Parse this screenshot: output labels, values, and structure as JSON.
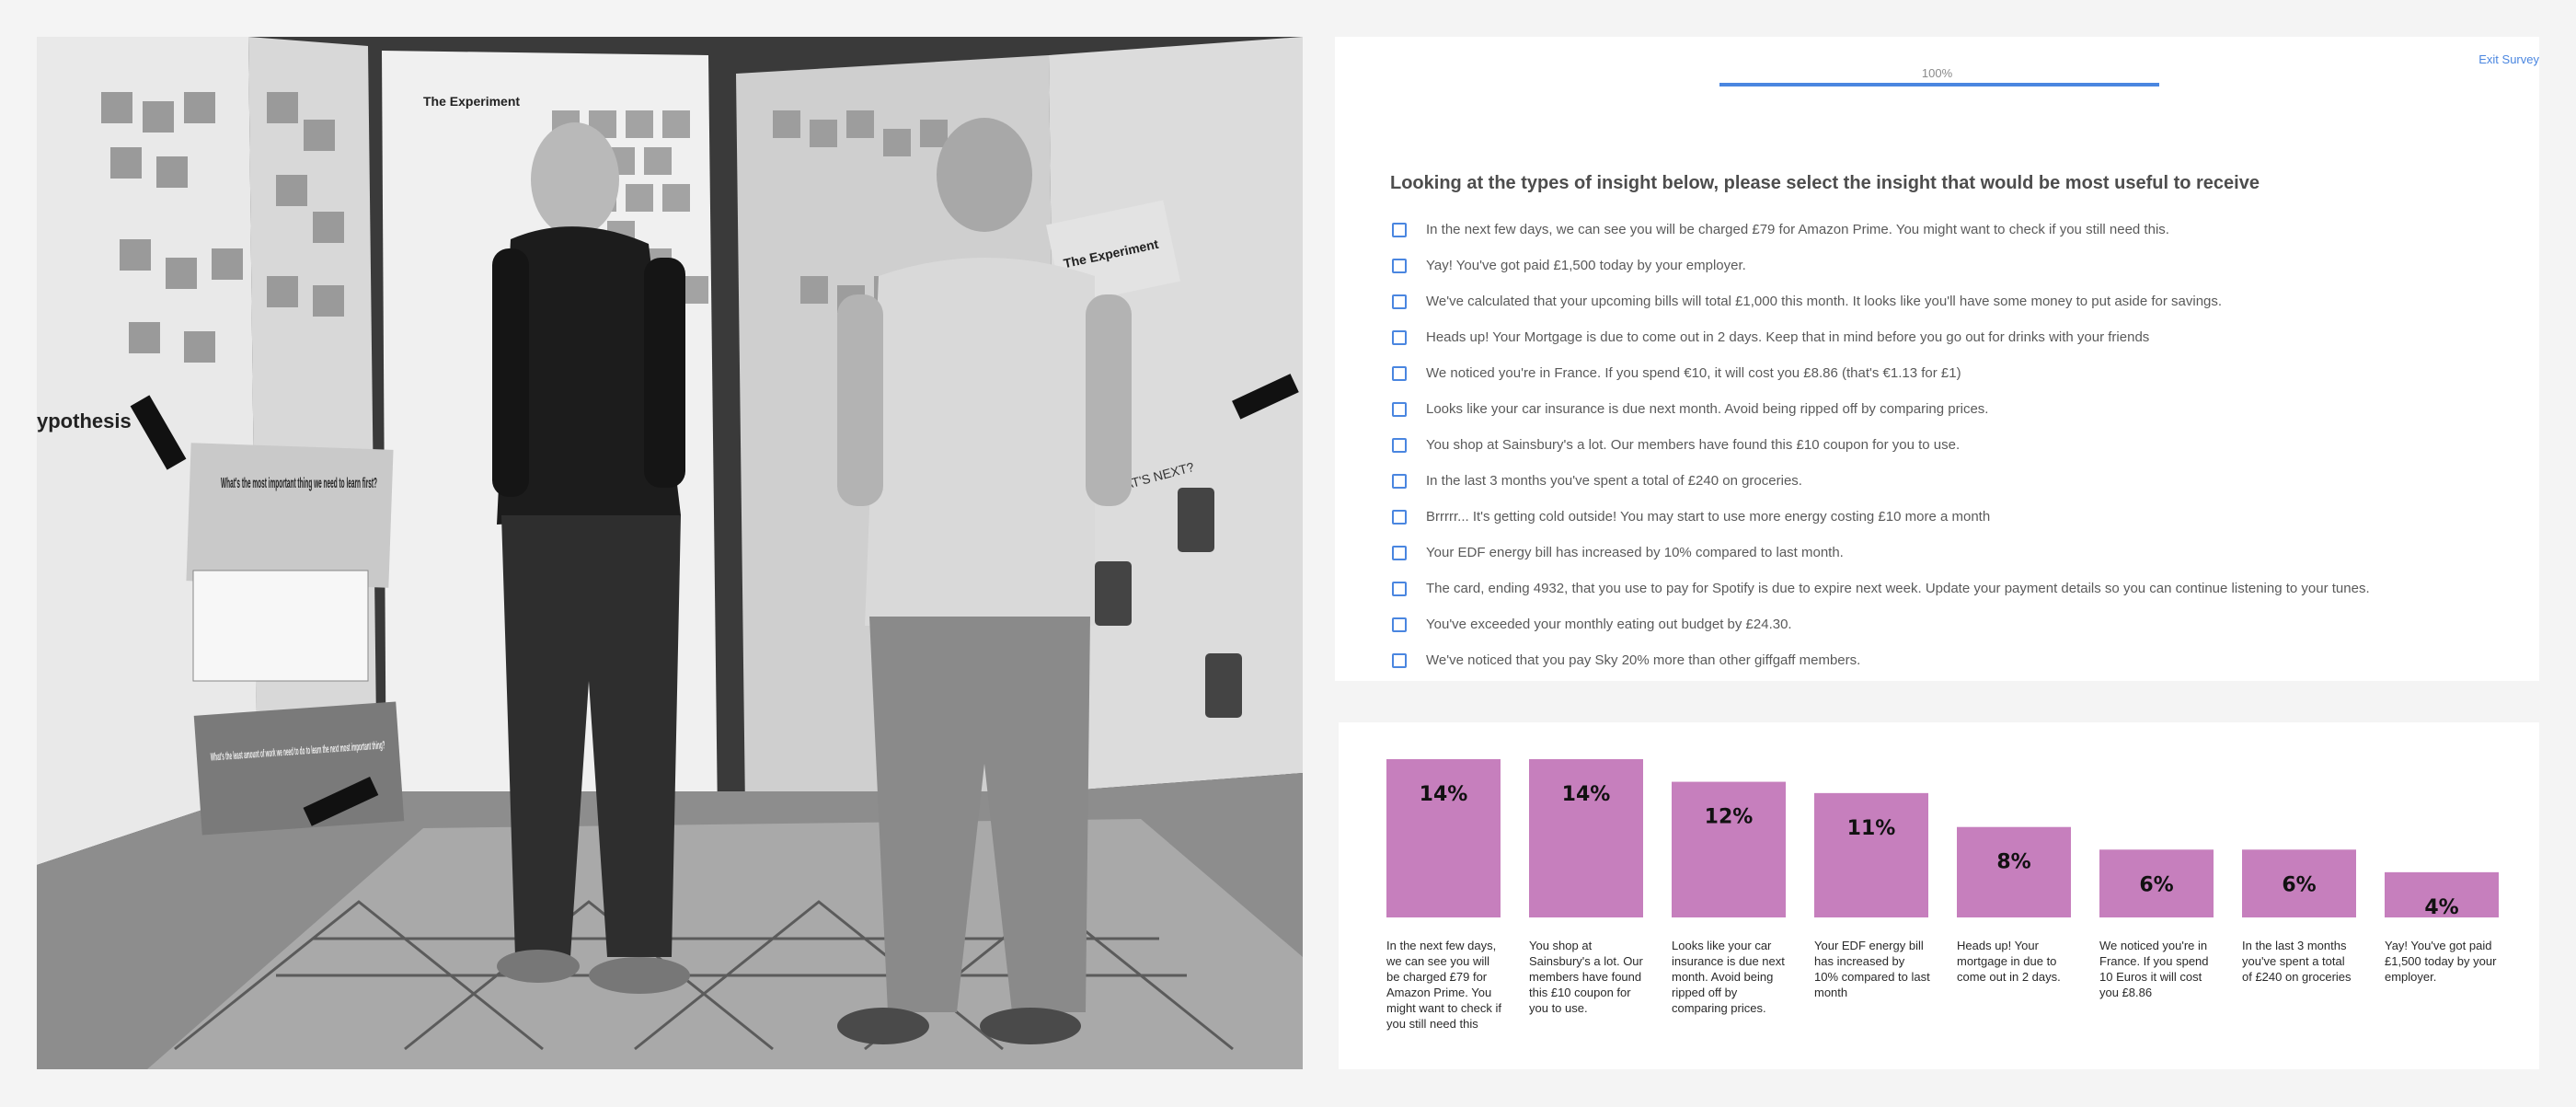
{
  "photo": {
    "wall_texts": {
      "hypothesis": "ypothesis",
      "learn_first_card": "What's the most important thing we need to learn first?",
      "smallest_work_card": "What's the least amount of work we need to do to learn the next most important thing?",
      "experiment_board_1": "The Experiment",
      "experiment_board_2": "The Experiment",
      "whats_next": "WHAT'S NEXT?"
    }
  },
  "survey": {
    "progress_label": "100%",
    "progress_value": 1.0,
    "exit_label": "Exit Survey",
    "question": "Looking at the types of insight below, please select the insight that would be most useful to receive",
    "options": [
      "In the next few days, we can see you will be charged £79 for Amazon Prime. You might want to check if you still need this.",
      "Yay! You've got paid £1,500 today by your employer.",
      "We've calculated that your upcoming bills will total £1,000 this month. It looks like you'll have some money to put aside for savings.",
      "Heads up! Your Mortgage is due to come out in 2 days. Keep that in mind before you go out for drinks with your friends",
      "We noticed you're in France. If you spend €10, it will cost you £8.86 (that's €1.13 for £1)",
      "Looks like your car insurance is due next month. Avoid being ripped off by comparing prices.",
      "You shop at Sainsbury's a lot. Our members have found this £10 coupon for you to use.",
      "In the last 3 months you've spent a total of £240 on groceries.",
      "Brrrrr... It's getting cold outside! You may start to use more energy costing £10 more a month",
      "Your EDF energy bill has increased by 10% compared to last month.",
      "The card, ending 4932, that you use to pay for Spotify is due to expire next week. Update your payment details so you can continue listening to your tunes.",
      "You've exceeded your monthly eating out budget by £24.30.",
      "We've noticed that you pay Sky 20% more than other giffgaff members."
    ]
  },
  "chart_data": {
    "type": "bar",
    "categories": [
      "In the next few days, we can see you will be charged £79 for Amazon Prime. You might want to check if you still need this",
      "You shop at Sainsbury's a lot. Our members have found this £10 coupon for you to use.",
      "Looks like your car insurance is due next month. Avoid being ripped off by comparing prices.",
      "Your EDF energy bill has increased by 10% compared to last month",
      "Heads up! Your mortgage in due to come out in 2 days.",
      "We noticed you're in France. If you spend 10 Euros it will cost you £8.86",
      "In the last 3 months you've spent a total of £240 on groceries",
      "Yay! You've got paid £1,500 today by your employer."
    ],
    "values": [
      14,
      14,
      12,
      11,
      8,
      6,
      6,
      4
    ],
    "value_labels": [
      "14%",
      "14%",
      "12%",
      "11%",
      "8%",
      "6%",
      "6%",
      "4%"
    ],
    "unit": "%",
    "ylim": [
      0,
      14
    ],
    "grid": false,
    "bar_color": "#c67fbd",
    "label_position": "inside-top"
  }
}
